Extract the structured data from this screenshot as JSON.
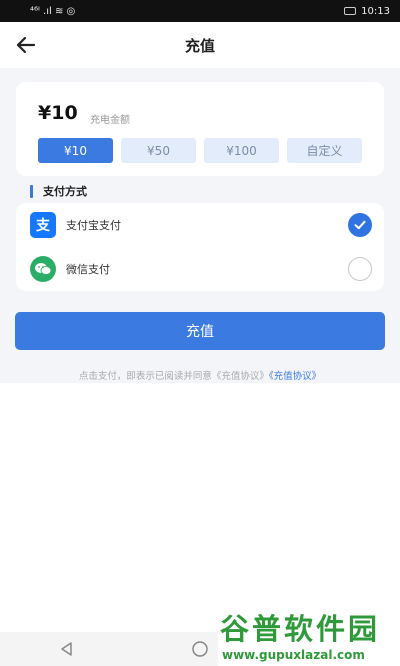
{
  "status_bar": {
    "left_text": "⁴⁶ᴵ .ıl ≋ ◎",
    "time": "10:13"
  },
  "header": {
    "title": "充值"
  },
  "amount": {
    "value": "¥10",
    "label": "充电金额",
    "options": [
      {
        "label": "¥10",
        "selected": true
      },
      {
        "label": "¥50",
        "selected": false
      },
      {
        "label": "¥100",
        "selected": false
      },
      {
        "label": "自定义",
        "selected": false
      }
    ]
  },
  "payment": {
    "section_title": "支付方式",
    "methods": [
      {
        "name": "支付宝支付",
        "icon": "alipay-icon",
        "checked": true
      },
      {
        "name": "微信支付",
        "icon": "wechat-icon",
        "checked": false
      }
    ]
  },
  "recharge_button": "充值",
  "agreement": {
    "text": "点击支付，即表示已阅读并同意《充值协议》",
    "link": "《充值协议》"
  },
  "watermark": {
    "title": "谷普软件园",
    "url": "www.gupuxlazal.com"
  },
  "colors": {
    "accent": "#3b7ae0",
    "alipay": "#1677ff",
    "wechat": "#2aae67"
  }
}
